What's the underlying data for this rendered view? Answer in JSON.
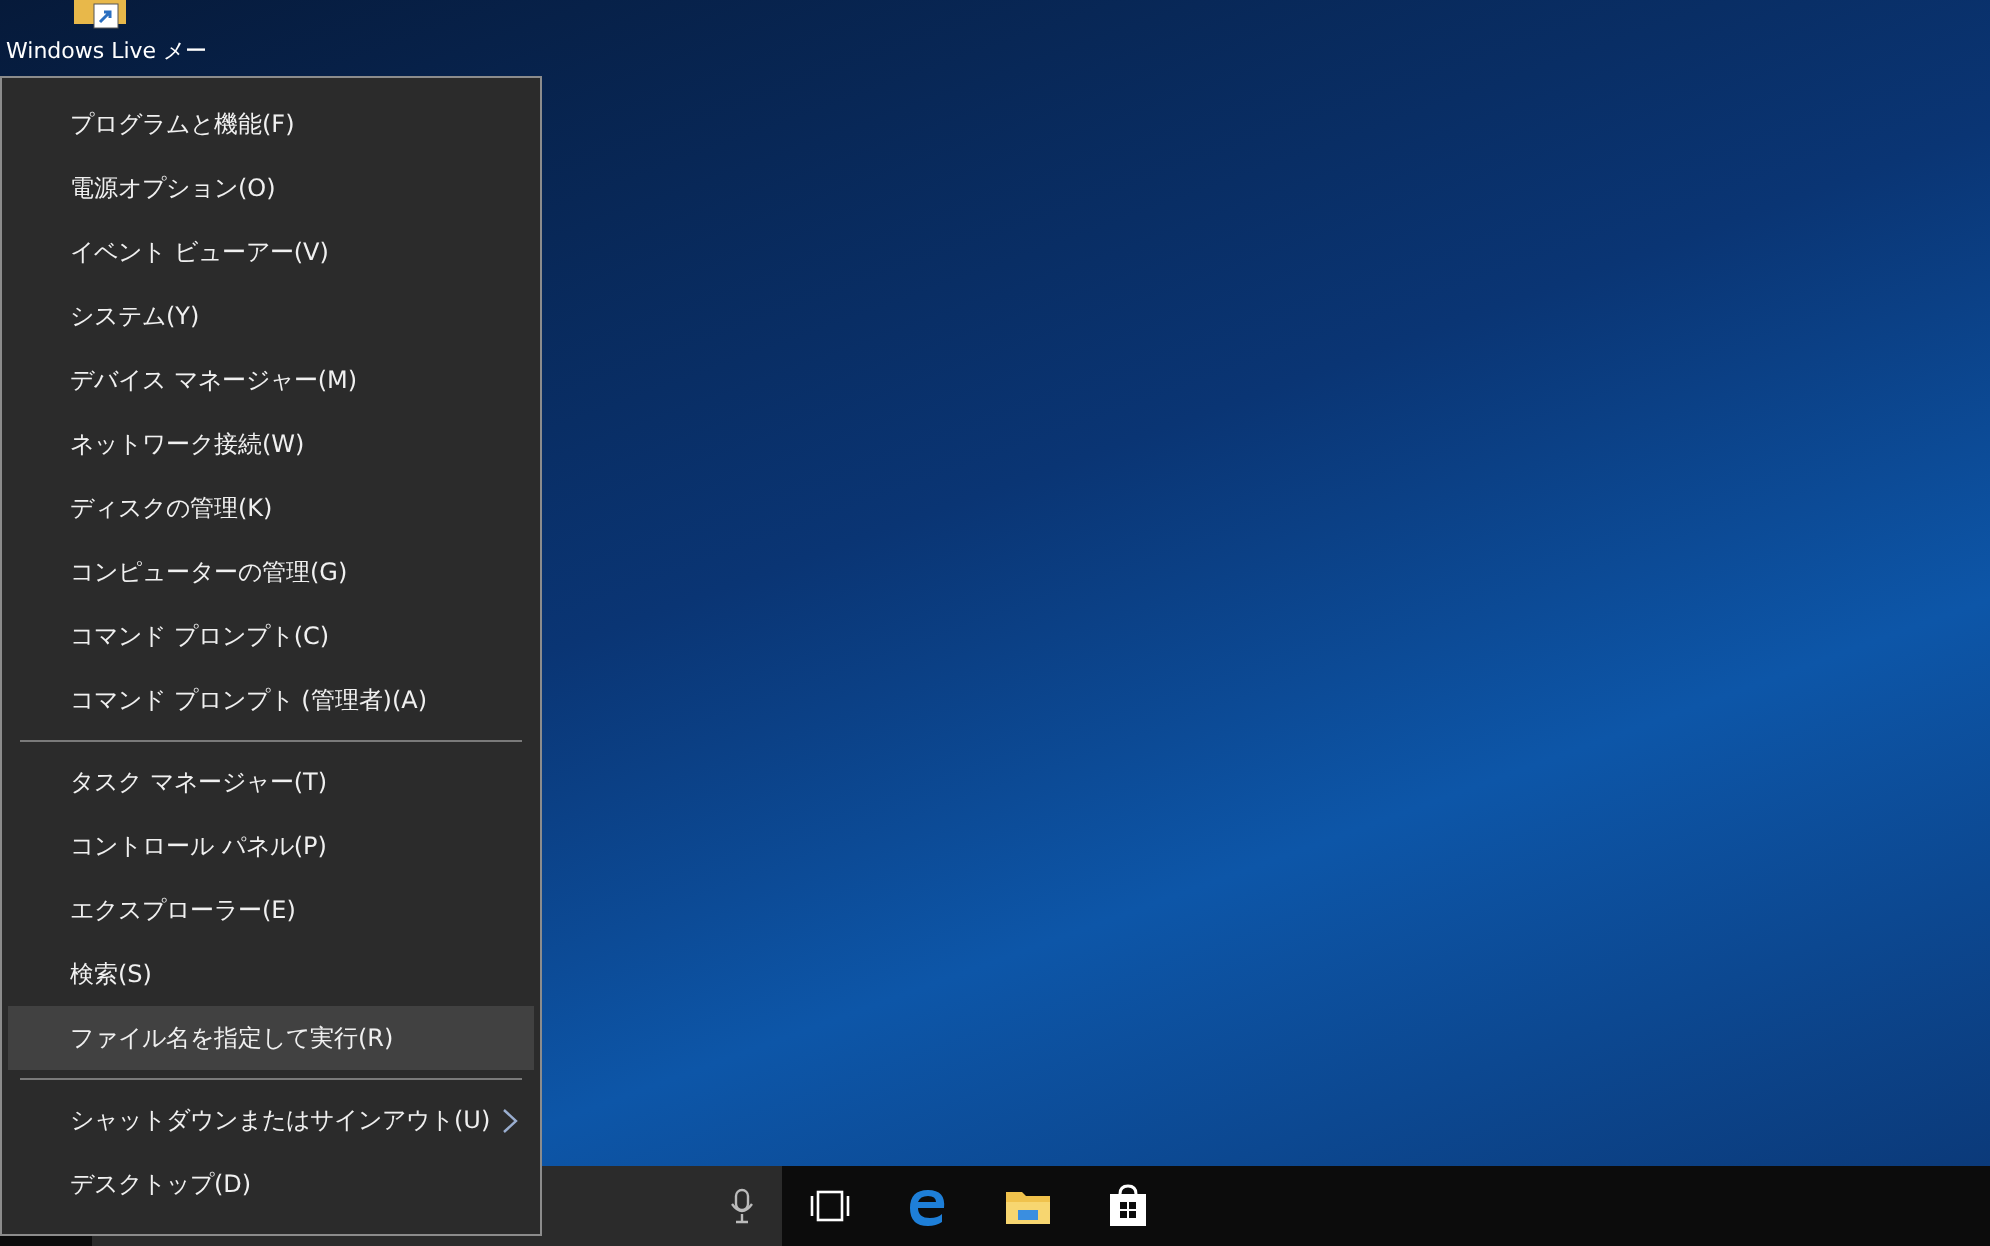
{
  "desktop_icon": {
    "label": "Windows Live メー"
  },
  "menu": {
    "groups": [
      {
        "items": [
          {
            "label": "プログラムと機能(F)",
            "kind": "command",
            "selected": false
          },
          {
            "label": "電源オプション(O)",
            "kind": "command",
            "selected": false
          },
          {
            "label": "イベント ビューアー(V)",
            "kind": "command",
            "selected": false
          },
          {
            "label": "システム(Y)",
            "kind": "command",
            "selected": false
          },
          {
            "label": "デバイス マネージャー(M)",
            "kind": "command",
            "selected": false
          },
          {
            "label": "ネットワーク接続(W)",
            "kind": "command",
            "selected": false
          },
          {
            "label": "ディスクの管理(K)",
            "kind": "command",
            "selected": false
          },
          {
            "label": "コンピューターの管理(G)",
            "kind": "command",
            "selected": false
          },
          {
            "label": "コマンド プロンプト(C)",
            "kind": "command",
            "selected": false
          },
          {
            "label": "コマンド プロンプト (管理者)(A)",
            "kind": "command",
            "selected": false
          }
        ]
      },
      {
        "items": [
          {
            "label": "タスク マネージャー(T)",
            "kind": "command",
            "selected": false
          },
          {
            "label": "コントロール パネル(P)",
            "kind": "command",
            "selected": false
          },
          {
            "label": "エクスプローラー(E)",
            "kind": "command",
            "selected": false
          },
          {
            "label": "検索(S)",
            "kind": "command",
            "selected": false
          },
          {
            "label": "ファイル名を指定して実行(R)",
            "kind": "command",
            "selected": true
          }
        ]
      },
      {
        "items": [
          {
            "label": "シャットダウンまたはサインアウト(U)",
            "kind": "submenu",
            "selected": false
          },
          {
            "label": "デスクトップ(D)",
            "kind": "command",
            "selected": false
          }
        ]
      }
    ]
  }
}
